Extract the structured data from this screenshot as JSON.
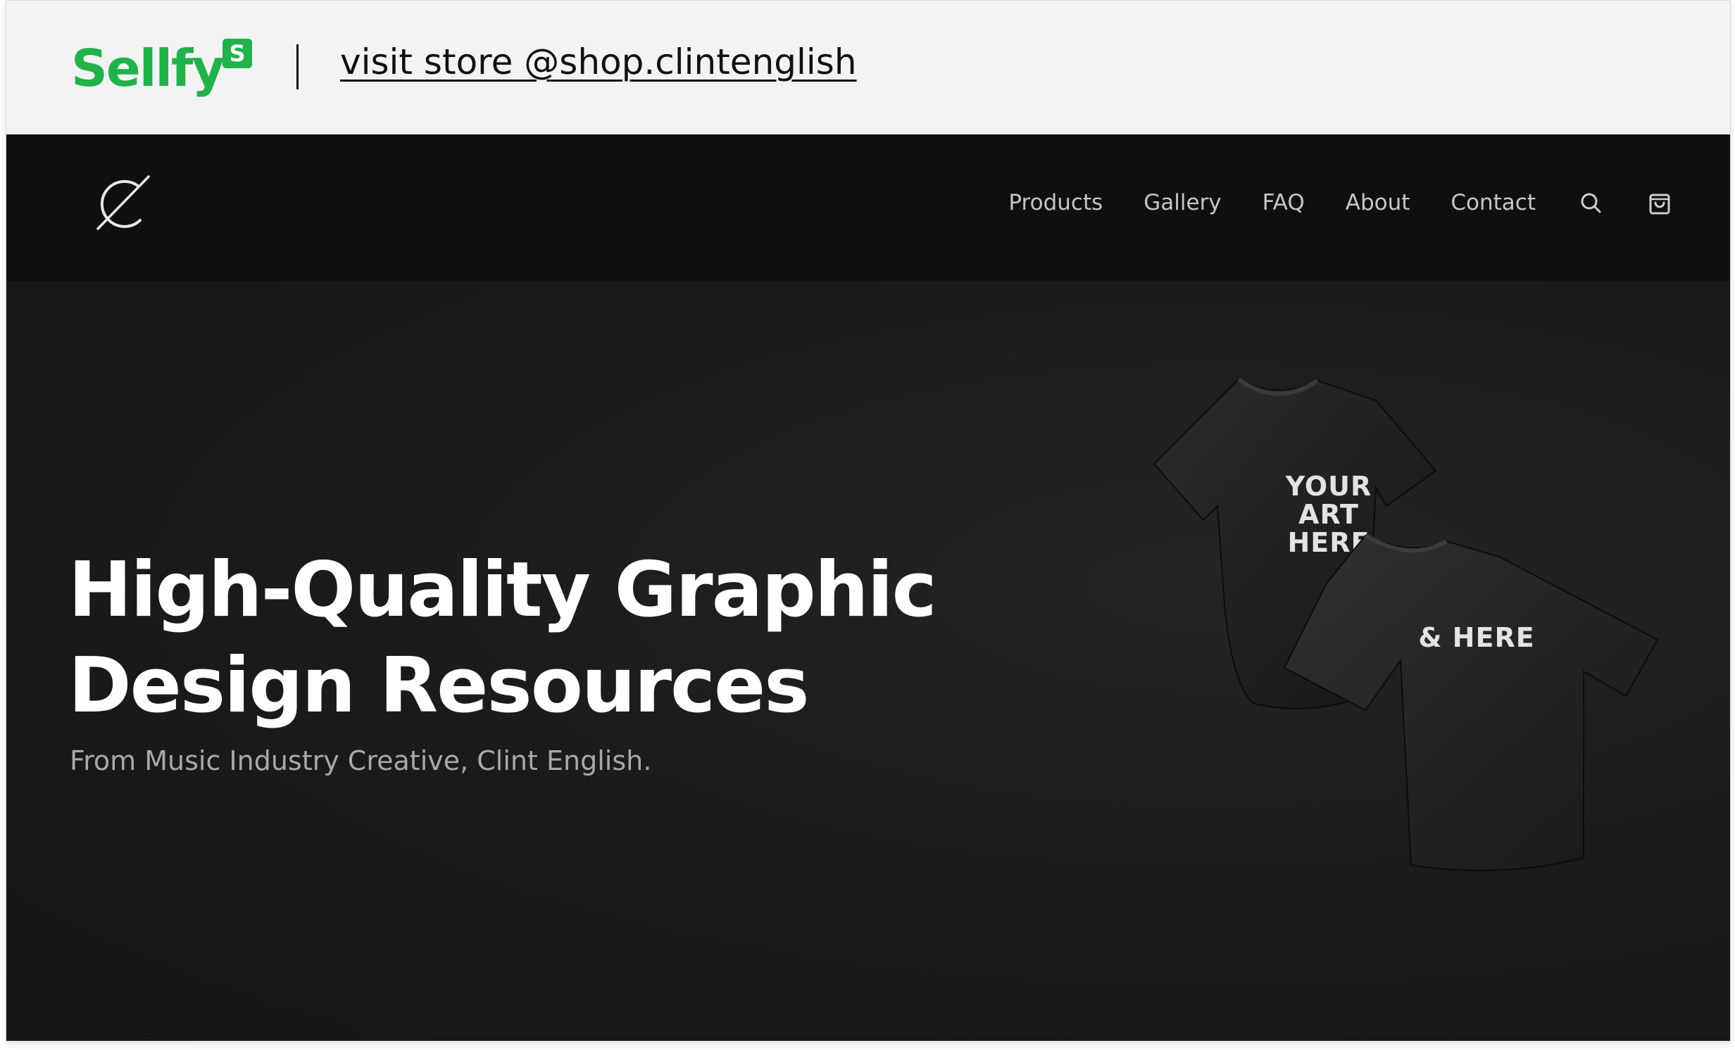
{
  "sellfy": {
    "brand": "Sellfy",
    "badge": "S",
    "visit_link": "visit store @shop.clintenglish",
    "brand_color": "#21b24b"
  },
  "nav": {
    "logo_icon": "ce-monogram-icon",
    "items": [
      {
        "label": "Products"
      },
      {
        "label": "Gallery"
      },
      {
        "label": "FAQ"
      },
      {
        "label": "About"
      },
      {
        "label": "Contact"
      }
    ],
    "search_icon": "search-icon",
    "cart_icon": "shopping-bag-icon"
  },
  "hero": {
    "title_line1": "High-Quality Graphic",
    "title_line2": "Design Resources",
    "subtitle": "From Music Industry Creative, Clint English.",
    "shirt_back": {
      "line1": "YOUR",
      "line2": "ART",
      "line3": "HERE"
    },
    "shirt_front": {
      "text": "& HERE"
    }
  }
}
